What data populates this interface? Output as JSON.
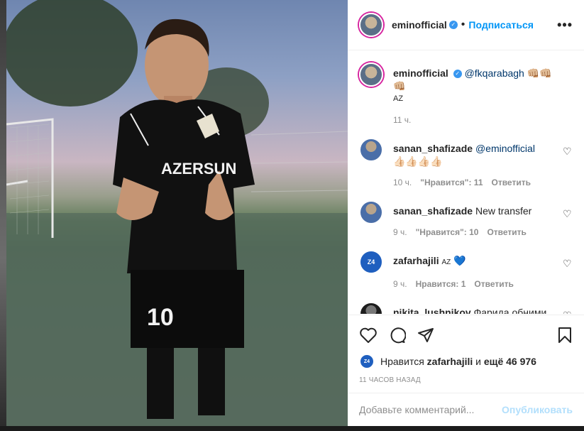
{
  "post": {
    "username": "eminofficial",
    "follow_label": "Подписаться",
    "more_label": "•••",
    "caption_mention": "@fkqarabagh",
    "caption_emoji": "👊🏼👊🏼👊🏼",
    "caption_suffix": "AZ",
    "caption_time": "11 ч."
  },
  "comments": [
    {
      "username": "sanan_shafizade",
      "text": "@eminofficial",
      "emoji": "👍🏻👍🏻👍🏻👍🏻",
      "time": "10 ч.",
      "likes": "\"Нравится\": 11",
      "reply": "Ответить"
    },
    {
      "username": "sanan_shafizade",
      "text": "New transfer",
      "emoji": "",
      "time": "9 ч.",
      "likes": "\"Нравится\": 10",
      "reply": "Ответить"
    },
    {
      "username": "zafarhajili",
      "text": "AZ",
      "emoji": "💙",
      "time": "9 ч.",
      "likes": "Нравится: 1",
      "reply": "Ответить"
    },
    {
      "username": "nikita_lushnikov",
      "text": "Фарида обними от меня",
      "emoji": "👊🏼",
      "time": "",
      "likes": "",
      "reply": ""
    }
  ],
  "likes_line": {
    "prefix": "Нравится",
    "user": "zafarhajili",
    "middle": "и",
    "others": "ещё 46 976"
  },
  "timestamp": "11 ЧАСОВ НАЗАД",
  "comment_box": {
    "placeholder": "Добавьте комментарий...",
    "post_label": "Опубликовать"
  },
  "photo": {
    "jersey_text": "AZERSUN",
    "shorts_number": "10"
  },
  "colors": {
    "accent": "#0095f6",
    "link": "#00376b",
    "muted": "#8e8e8e",
    "post_disabled": "#b2dffc"
  }
}
